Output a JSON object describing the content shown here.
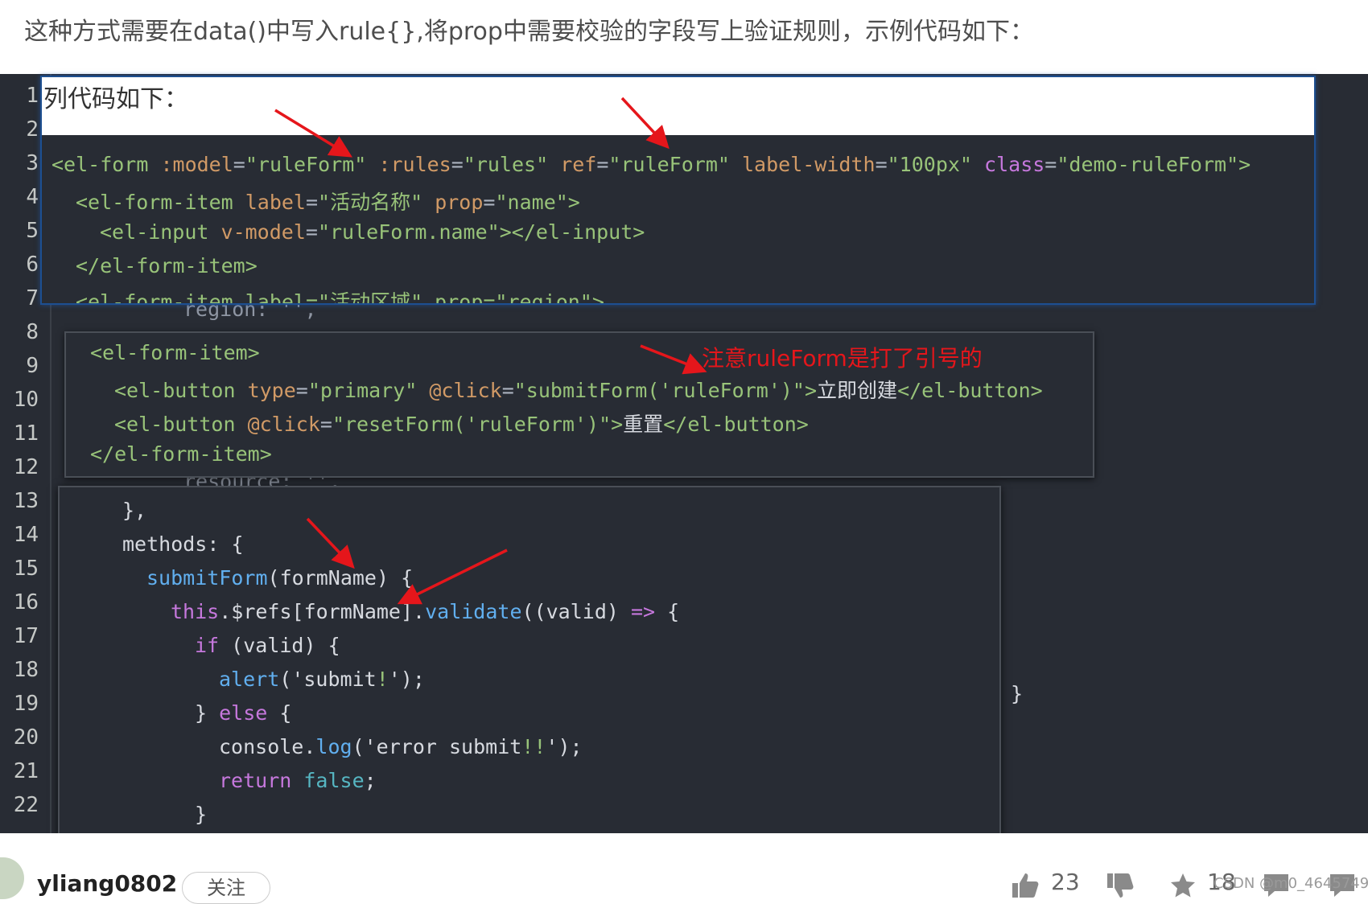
{
  "intro_text": "这种方式需要在data()中写入rule{},将prop中需要校验的字段写上验证规则，示例代码如下：",
  "panel1_heading": "列代码如下：",
  "line_numbers": [
    "1",
    "2",
    "3",
    "4",
    "5",
    "6",
    "7",
    "8",
    "9",
    "10",
    "11",
    "12",
    "13",
    "14",
    "15",
    "16",
    "17",
    "18",
    "19",
    "20",
    "21",
    "22"
  ],
  "background_code": {
    "line7_region": "region: '',",
    "line12_resource": "resource: '',",
    "line18_brace": "}"
  },
  "panel1_code": {
    "line3": {
      "t1": "<el-form ",
      "a1": ":model",
      "p1": "=",
      "s1": "\"ruleForm\"",
      "a2": " :rules",
      "p2": "=",
      "s2": "\"rules\"",
      "a3": " ref",
      "p3": "=",
      "s3": "\"ruleForm\"",
      "a4": " label-width",
      "p4": "=",
      "s4": "\"100px\"",
      "k1": " class",
      "p5": "=",
      "s5": "\"demo-ruleForm\"",
      "t2": ">"
    },
    "line4": {
      "t1": "<el-form-item ",
      "a1": "label",
      "p1": "=",
      "s1": "\"活动名称\"",
      "a2": " prop",
      "p2": "=",
      "s2": "\"name\"",
      "t2": ">"
    },
    "line5": {
      "t1": "<el-input ",
      "a1": "v-model",
      "p1": "=",
      "s1": "\"ruleForm.name\"",
      "t2": "></el-input>"
    },
    "line6": {
      "t1": "</el-form-item>"
    },
    "line7": "<el-form-item label=\"活动区域\" prop=\"region\">"
  },
  "panel2_code": {
    "line8": "<el-form-item>",
    "line9": {
      "t1": "<el-button ",
      "a1": "type",
      "p1": "=",
      "s1": "\"primary\"",
      "a2": " @click",
      "p2": "=",
      "s2": "\"submitForm('ruleForm')\"",
      "t2": ">",
      "txt": "立即创建",
      "t3": "</el-button>"
    },
    "line10": {
      "t1": "<el-button ",
      "a1": "@click",
      "p1": "=",
      "s1": "\"resetForm('ruleForm')\"",
      "t2": ">",
      "txt": "重置",
      "t3": "</el-button>"
    },
    "line11": "</el-form-item>"
  },
  "annotation_note": "注意ruleForm是打了引号的",
  "panel3_code": {
    "line13": "},",
    "line14": {
      "k": "methods",
      "p": ": {"
    },
    "line15": {
      "f": "submitForm",
      "p": "(formName) {"
    },
    "line16": {
      "k": "this",
      "p1": ".$refs[formName].",
      "f": "validate",
      "p2": "((valid) ",
      "op": "=>",
      "p3": " {"
    },
    "line17": {
      "k": "if",
      "p": " (valid) {"
    },
    "line18": {
      "f": "alert",
      "p1": "('submit",
      "b": "!",
      "p2": "');"
    },
    "line19": {
      "p1": "} ",
      "k": "else",
      "p2": " {"
    },
    "line20": {
      "p1": "console.",
      "f": "log",
      "p2": "('error submit",
      "b": "!!",
      "p3": "');"
    },
    "line21": {
      "k": "return",
      "b": " false",
      "p": ";"
    },
    "line22": "}",
    "line23": "});"
  },
  "footer": {
    "username": "yliang0802",
    "follow_label": "关注",
    "like_count": "23",
    "favorite_count": "18",
    "watermark": "CSDN @m0_46457497"
  },
  "colors": {
    "editor_bg": "#282c34",
    "tag": "#98c379",
    "attr": "#d19a66",
    "keyword": "#c678dd",
    "function": "#61afef",
    "annotation_red": "#e5161b"
  }
}
